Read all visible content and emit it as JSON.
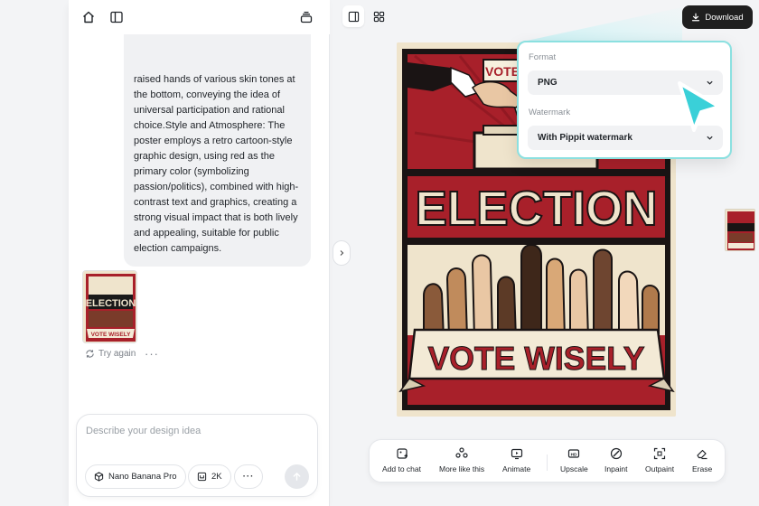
{
  "chat": {
    "message_lines": [
      "raised hands of various skin tones at",
      "the bottom, conveying the idea of",
      "universal participation and rational",
      "choice.Style and Atmosphere: The",
      "poster employs a retro cartoon-style",
      "graphic design, using red as the",
      "primary color (symbolizing",
      "passion/politics), combined with high-",
      "contrast text and graphics, creating a",
      "strong visual impact that is both lively",
      "and appealing, suitable for public",
      "election campaigns."
    ],
    "try_again": "Try again",
    "more": "···"
  },
  "input": {
    "placeholder": "Describe your design idea",
    "model": "Nano Banana Pro",
    "resolution": "2K",
    "more": "···"
  },
  "toolbar": {
    "download": "Download",
    "tools": [
      "Add to chat",
      "More like this",
      "Animate",
      "Upscale",
      "Inpaint",
      "Outpaint",
      "Erase"
    ]
  },
  "export": {
    "format_label": "Format",
    "format_value": "PNG",
    "watermark_label": "Watermark",
    "watermark_value": "With Pippit watermark"
  },
  "poster": {
    "headline": "ELECTION",
    "banner": "VOTE WISELY",
    "sign": "VOTE"
  },
  "colors": {
    "accent_cyan": "#3ad0d8",
    "poster_red": "#a8202a",
    "poster_cream": "#efe4cc",
    "dark_button": "#1f1f1f"
  }
}
